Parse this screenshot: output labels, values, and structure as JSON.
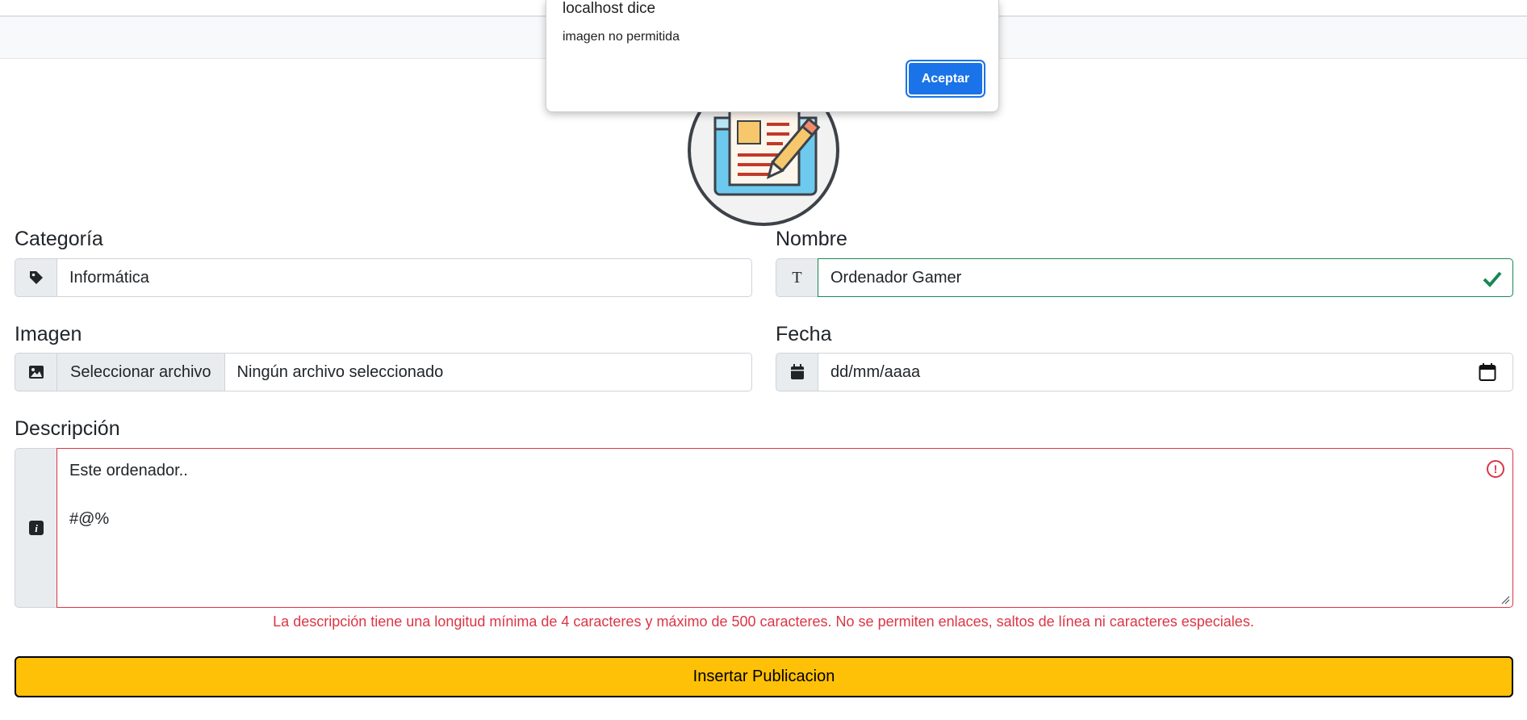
{
  "dialog": {
    "title": "localhost dice",
    "message": "imagen no permitida",
    "accept_label": "Aceptar"
  },
  "form": {
    "categoria": {
      "label": "Categoría",
      "value": "Informática",
      "icon": "tag-icon"
    },
    "nombre": {
      "label": "Nombre",
      "value": "Ordenador Gamer",
      "icon": "text-t-icon",
      "state": "valid"
    },
    "imagen": {
      "label": "Imagen",
      "button_label": "Seleccionar archivo",
      "value": "Ningún archivo seleccionado",
      "icon": "image-icon"
    },
    "fecha": {
      "label": "Fecha",
      "placeholder": "dd/mm/aaaa",
      "icon": "calendar-icon"
    },
    "descripcion": {
      "label": "Descripción",
      "lines": [
        "Este ordenador..",
        "",
        "#@%"
      ],
      "icon": "info-icon",
      "state": "invalid",
      "feedback": "La descripción tiene una longitud mínima de 4 caracteres y máximo de 500 caracteres. No se permiten enlaces, saltos de línea ni caracteres especiales."
    },
    "submit_label": "Insertar Publicacion"
  },
  "colors": {
    "valid": "#198754",
    "invalid": "#dc3545",
    "submit_bg": "#ffc107",
    "dialog_button": "#1a73e8"
  }
}
